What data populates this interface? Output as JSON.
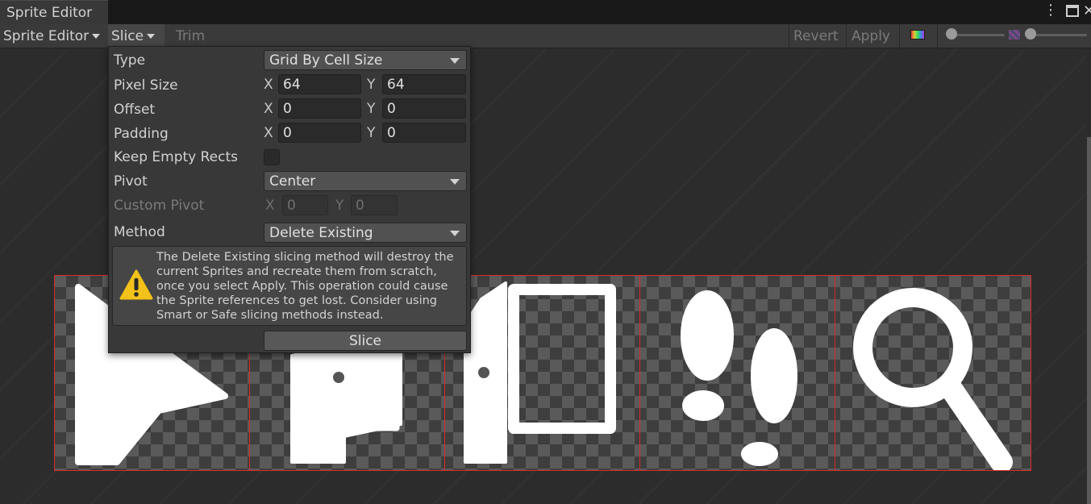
{
  "window": {
    "tab_title": "Sprite Editor",
    "menu_icon": "kebab-menu-icon",
    "maximize_icon": "maximize-icon",
    "close_icon": "close-icon"
  },
  "toolbar": {
    "editor_mode": "Sprite Editor",
    "slice_label": "Slice",
    "trim_label": "Trim",
    "revert_label": "Revert",
    "apply_label": "Apply",
    "color_icon": "rgb-channel-icon",
    "mip_icon": "mip-level-icon"
  },
  "slice_popup": {
    "type": {
      "label": "Type",
      "value": "Grid By Cell Size"
    },
    "pixel_size": {
      "label": "Pixel Size",
      "x_label": "X",
      "x": "64",
      "y_label": "Y",
      "y": "64"
    },
    "offset": {
      "label": "Offset",
      "x_label": "X",
      "x": "0",
      "y_label": "Y",
      "y": "0"
    },
    "padding": {
      "label": "Padding",
      "x_label": "X",
      "x": "0",
      "y_label": "Y",
      "y": "0"
    },
    "keep_empty_rects": {
      "label": "Keep Empty Rects",
      "checked": false
    },
    "pivot": {
      "label": "Pivot",
      "value": "Center"
    },
    "custom_pivot": {
      "label": "Custom Pivot",
      "x_label": "X",
      "x": "0",
      "y_label": "Y",
      "y": "0"
    },
    "method": {
      "label": "Method",
      "value": "Delete Existing"
    },
    "warning": {
      "icon": "warning-icon",
      "text": "The Delete Existing slicing method will destroy the current Sprites and recreate them from scratch, once you select Apply. This operation could cause the Sprite references to get lost. Consider using Smart or Safe slicing methods instead."
    },
    "slice_button": "Slice"
  },
  "colors": {
    "slice_border": "#d82a2a",
    "warning": "#f2c21a",
    "background": "#2b2b2b"
  }
}
